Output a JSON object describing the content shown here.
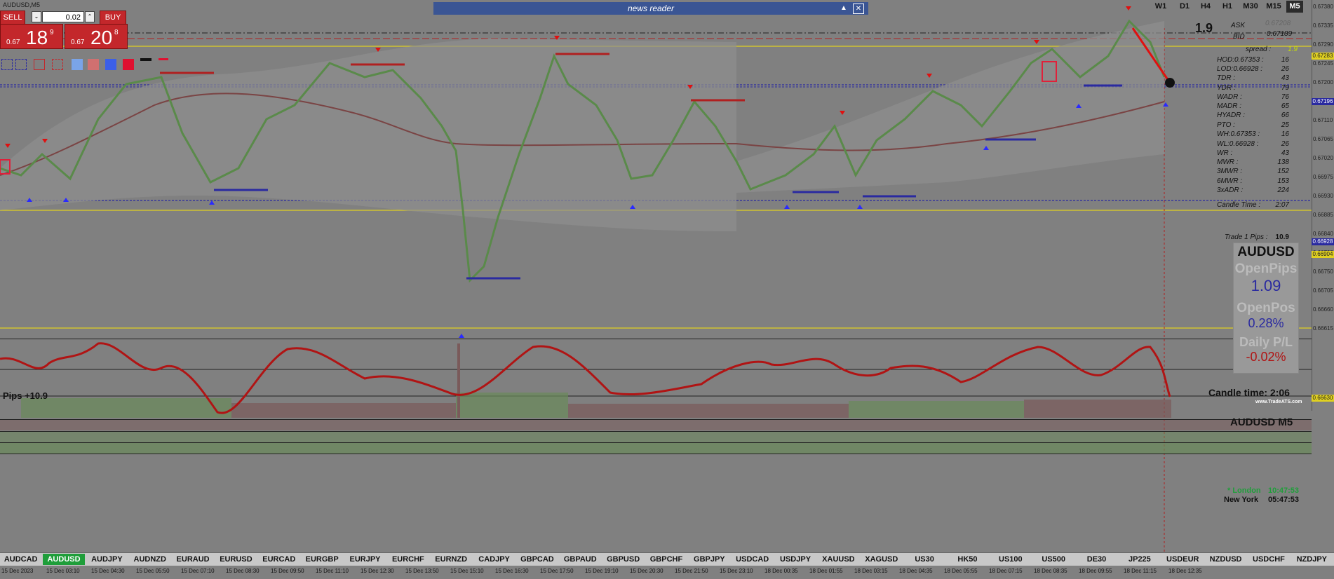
{
  "window": {
    "title": "AUDUSD,M5"
  },
  "trade_panel": {
    "sell_label": "SELL",
    "buy_label": "BUY",
    "lot": "0.02",
    "sell_price": {
      "prefix": "0.67",
      "big": "18",
      "sup": "9"
    },
    "buy_price": {
      "prefix": "0.67",
      "big": "20",
      "sup": "8"
    }
  },
  "news_reader": {
    "label": "news reader"
  },
  "timeframes": [
    "W1",
    "D1",
    "H4",
    "H1",
    "M30",
    "M15",
    "M5"
  ],
  "active_timeframe": "M5",
  "info": {
    "spread_value": "1.9",
    "ask_label": "ASK",
    "ask_value": "0.67208",
    "bid_label": "BID",
    "bid_value": "0.67189",
    "spread_label": "spread :",
    "spread_num": "1.9",
    "stats": [
      {
        "label": "HOD:0.67353 :",
        "value": "16"
      },
      {
        "label": "LOD:0.66928 :",
        "value": "26"
      },
      {
        "label": "TDR :",
        "value": "43"
      },
      {
        "label": "YDR :",
        "value": "79"
      },
      {
        "label": "WADR :",
        "value": "76"
      },
      {
        "label": "MADR :",
        "value": "65"
      },
      {
        "label": "HYADR :",
        "value": "66"
      },
      {
        "label": "PTO :",
        "value": "25"
      },
      {
        "label": "WH:0.67353 :",
        "value": "16"
      },
      {
        "label": "WL:0.66928 :",
        "value": "26"
      },
      {
        "label": "WR :",
        "value": "43"
      },
      {
        "label": "MWR :",
        "value": "138"
      },
      {
        "label": "3MWR :",
        "value": "152"
      },
      {
        "label": "6MWR :",
        "value": "153"
      },
      {
        "label": "3xADR :",
        "value": "224"
      },
      {
        "label": "Candle Time :",
        "value": "2:07"
      }
    ],
    "trade_pips_label": "Trade 1 Pips :",
    "trade_pips_value": "10.9"
  },
  "summary_box": {
    "symbol": "AUDUSD",
    "open_pips_label": "OpenPips",
    "open_pips_value": "1.09",
    "open_pos_label": "OpenPos",
    "open_pos_value": "0.28%",
    "daily_pl_label": "Daily P/L",
    "daily_pl_value": "-0.02%"
  },
  "footer": {
    "pips": "Pips +10.9",
    "candle_time": "Candle time: 2:06",
    "watermark": "www.TradeATS.com",
    "sub_symbol": "AUDUSD  M5",
    "london": "* London",
    "london_time": "10:47:53",
    "newyork": "New York",
    "newyork_time": "05:47:53"
  },
  "price_axis": [
    "0.67380",
    "0.67335",
    "0.67290",
    "0.67245",
    "0.67200",
    "0.67155",
    "0.67110",
    "0.67065",
    "0.67020",
    "0.66975",
    "0.66930",
    "0.66885",
    "0.66840",
    "0.66795",
    "0.66750",
    "0.66705",
    "0.66660",
    "0.66615"
  ],
  "price_tags": {
    "yellow_top": "0.67283",
    "blue_top": "0.67196",
    "blue_bottom": "0.66928",
    "yellow_bottom": "0.66904",
    "yellow_low": "0.66630"
  },
  "symbols": [
    "AUDCAD",
    "AUDUSD",
    "AUDJPY",
    "AUDNZD",
    "EURAUD",
    "EURUSD",
    "EURCAD",
    "EURGBP",
    "EURJPY",
    "EURCHF",
    "EURNZD",
    "CADJPY",
    "GBPCAD",
    "GBPAUD",
    "GBPUSD",
    "GBPCHF",
    "GBPJPY",
    "USDCAD",
    "USDJPY",
    "XAUUSD",
    "XAGUSD",
    "US30",
    "HK50",
    "US100",
    "US500",
    "DE30",
    "JP225",
    "USDEUR",
    "NZDUSD",
    "USDCHF",
    "NZDJPY"
  ],
  "active_symbol": "AUDUSD",
  "time_axis": [
    "15 Dec 2023",
    "15 Dec 03:10",
    "15 Dec 04:30",
    "15 Dec 05:50",
    "15 Dec 07:10",
    "15 Dec 08:30",
    "15 Dec 09:50",
    "15 Dec 11:10",
    "15 Dec 12:30",
    "15 Dec 13:50",
    "15 Dec 15:10",
    "15 Dec 16:30",
    "15 Dec 17:50",
    "15 Dec 19:10",
    "15 Dec 20:30",
    "15 Dec 21:50",
    "15 Dec 23:10",
    "18 Dec 00:35",
    "18 Dec 01:55",
    "18 Dec 03:15",
    "18 Dec 04:35",
    "18 Dec 05:55",
    "18 Dec 07:15",
    "18 Dec 08:35",
    "18 Dec 09:55",
    "18 Dec 11:15",
    "18 Dec 12:35"
  ],
  "colors": {
    "sell": "#c3272b",
    "buy": "#c3272b",
    "bull": "#5a8a4a",
    "bear": "#8c5a5a",
    "level_blue": "#2a2aa0",
    "level_red": "#b02020",
    "yellow": "#e0d020",
    "news": "#3a5594",
    "active_symbol": "#1f9e3a"
  }
}
